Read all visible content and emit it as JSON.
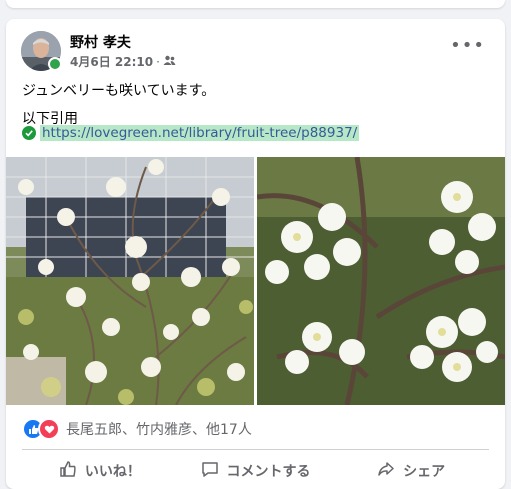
{
  "post": {
    "author": "野村 孝夫",
    "date": "4月6日 22:10",
    "dot": "·",
    "audience_icon": "friends-icon",
    "more_label": "•••",
    "text_line1": "ジュンベリーも咲いています。",
    "text_line2": "以下引用",
    "link_url": "https://lovegreen.net/library/fruit-tree/p88937/"
  },
  "reactions": {
    "icons": [
      "like-icon",
      "love-icon"
    ],
    "summary": "長尾五郎、竹内雅彦、他17人"
  },
  "actions": {
    "like": "いいね！",
    "comment": "コメントする",
    "share": "シェア"
  },
  "colors": {
    "like_blue": "#1877f2",
    "love_red": "#f33e58",
    "link_highlight": "#b6e8c7",
    "online_green": "#31a24c"
  }
}
